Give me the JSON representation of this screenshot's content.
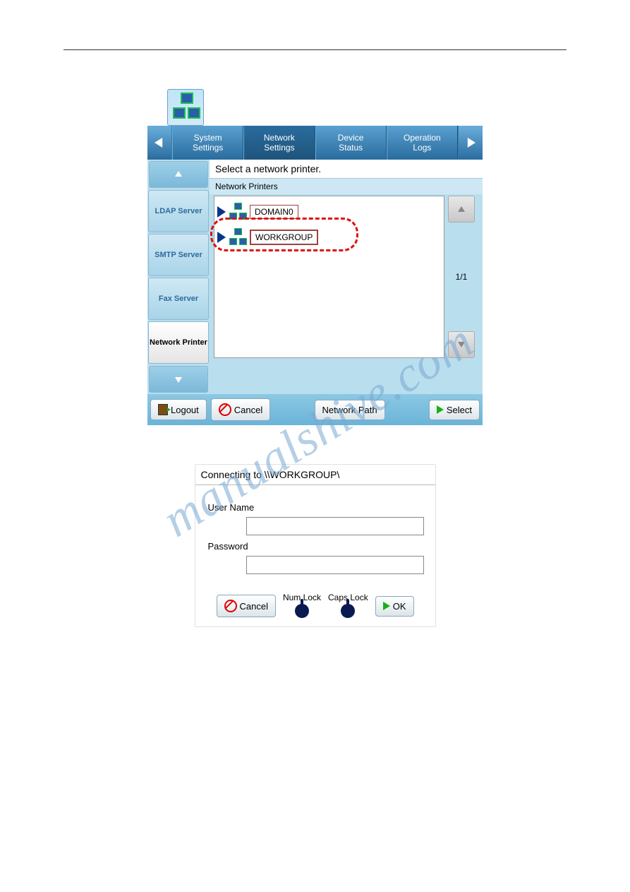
{
  "watermark_text": "manualshive.com",
  "screenshot1": {
    "tabs": {
      "prev_arrow": "◀",
      "next_arrow": "▶",
      "items": [
        {
          "line1": "System",
          "line2": "Settings"
        },
        {
          "line1": "Network",
          "line2": "Settings",
          "active": true
        },
        {
          "line1": "Device",
          "line2": "Status"
        },
        {
          "line1": "Operation",
          "line2": "Logs"
        }
      ]
    },
    "sidebar": {
      "items": [
        {
          "label": "LDAP Server"
        },
        {
          "label": "SMTP Server"
        },
        {
          "label": "Fax Server"
        },
        {
          "label": "Network Printer",
          "active": true
        }
      ]
    },
    "main": {
      "title": "Select a network printer.",
      "list_label": "Network Printers",
      "rows": [
        {
          "label": "DOMAIN0"
        },
        {
          "label": "WORKGROUP",
          "selected": true,
          "highlighted": true
        }
      ],
      "page_indicator": "1/1"
    },
    "bottom": {
      "logout": "Logout",
      "cancel": "Cancel",
      "network_path": "Network Path",
      "select": "Select"
    }
  },
  "screenshot2": {
    "title": "Connecting to \\\\WORKGROUP\\",
    "username_label": "User Name",
    "password_label": "Password",
    "cancel": "Cancel",
    "numlock": "Num Lock",
    "capslock": "Caps Lock",
    "ok": "OK"
  }
}
